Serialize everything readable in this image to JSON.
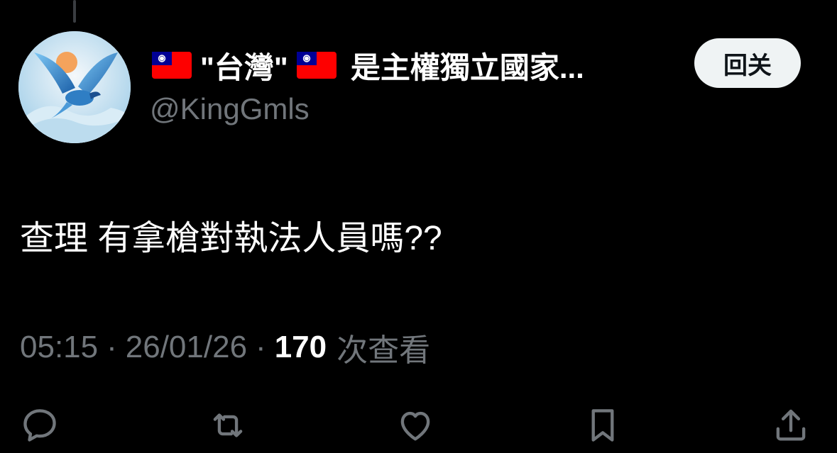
{
  "user": {
    "display_name_parts": [
      "\"台灣\"",
      "是主權獨立國家..."
    ],
    "handle": "@KingGmls",
    "follow_label": "回关"
  },
  "tweet": {
    "text": "查理 有拿槍對執法人員嗎??",
    "time": "05:15",
    "date": "26/01/26",
    "view_count": "170",
    "view_label": "次查看",
    "separator": "·"
  },
  "actions": [
    "reply-icon",
    "retweet-icon",
    "like-icon",
    "bookmark-icon",
    "share-icon"
  ],
  "colors": {
    "background": "#000000",
    "primary_text": "#ffffff",
    "secondary_text": "#71767b",
    "follow_button_bg": "#eff3f4",
    "flag_red": "#fe0000",
    "flag_blue": "#000095"
  }
}
